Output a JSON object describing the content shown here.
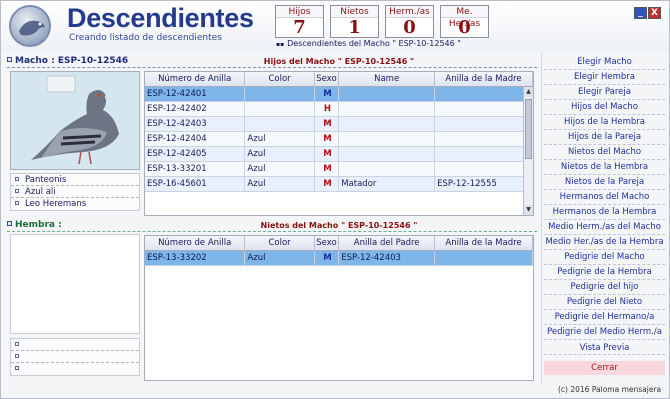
{
  "window": {
    "title": "Descendientes",
    "subtitle": "Creando listado de descendientes",
    "minimize": "_",
    "close": "X"
  },
  "counters": [
    {
      "label": "Hijos",
      "value": "7"
    },
    {
      "label": "Nietos",
      "value": "1"
    },
    {
      "label": "Herm./as",
      "value": "0"
    },
    {
      "label": "Me. Her./as",
      "value": "0"
    }
  ],
  "header_caption": "Descendientes del Macho \" ESP-10-12546 \"",
  "macho": {
    "title": "Macho : ESP-10-12546",
    "names": [
      "Panteonis",
      "Azul ali",
      "Leo Heremans"
    ]
  },
  "hembra": {
    "title": "Hembra :",
    "names": [
      "",
      "",
      ""
    ]
  },
  "hijos": {
    "caption": "Hijos del Macho \" ESP-10-12546 \"",
    "columns": [
      "Número de Anilla",
      "Color",
      "Sexo",
      "Name",
      "Anilla de la Madre"
    ],
    "rows": [
      [
        "ESP-12-42401",
        "",
        "M",
        "",
        ""
      ],
      [
        "ESP-12-42402",
        "",
        "H",
        "",
        ""
      ],
      [
        "ESP-12-42403",
        "",
        "M",
        "",
        ""
      ],
      [
        "ESP-12-42404",
        "Azul",
        "M",
        "",
        ""
      ],
      [
        "ESP-12-42405",
        "Azul",
        "M",
        "",
        ""
      ],
      [
        "ESP-13-33201",
        "Azul",
        "M",
        "",
        ""
      ],
      [
        "ESP-16-45601",
        "Azul",
        "M",
        "Matador",
        "ESP-12-12555"
      ]
    ]
  },
  "nietos": {
    "caption": "Nietos del Macho \" ESP-10-12546 \"",
    "columns": [
      "Número de Anilla",
      "Color",
      "Sexo",
      "Anilla del Padre",
      "Anilla de la Madre"
    ],
    "rows": [
      [
        "ESP-13-33202",
        "Azul",
        "M",
        "ESP-12-42403",
        ""
      ]
    ]
  },
  "menu": [
    "Elegir Macho",
    "Elegir Hembra",
    "Elegir Pareja",
    "Hijos del Macho",
    "Hijos de la Hembra",
    "Hijos de la Pareja",
    "Nietos del Macho",
    "Nietos de la Hembra",
    "Nietos de la Pareja",
    "Hermanos del Macho",
    "Hermanos de la Hembra",
    "Medio Herm./as del Macho",
    "Medio Her./as de la Hembra",
    "Pedigrie del Macho",
    "Pedigrie de la Hembra",
    "Pedigrie del hijo",
    "Pedigrie del Nieto",
    "Pedigrie del Hermano/a",
    "Pedigrie del Medio Herm./a"
  ],
  "preview_label": "Vista Previa",
  "close_label": "Cerrar",
  "footer": "(c) 2016 Paloma mensajera",
  "colors": {
    "title": "#243a8c",
    "accent_red": "#8a1010",
    "selection": "#7fb6ea"
  }
}
